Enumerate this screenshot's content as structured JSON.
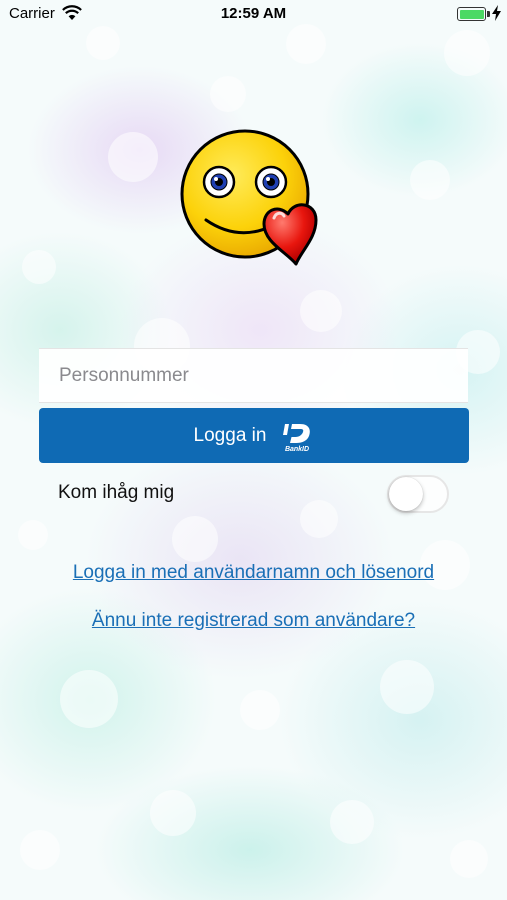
{
  "status_bar": {
    "carrier": "Carrier",
    "time": "12:59 AM",
    "battery_level": 1.0,
    "battery_color": "#4cd964"
  },
  "logo": {
    "icon": "smiley-heart-icon"
  },
  "login": {
    "personnummer_placeholder": "Personnummer",
    "personnummer_value": "",
    "button_label": "Logga in",
    "button_icon": "bankid-icon",
    "button_color": "#0f6ab4"
  },
  "remember_me": {
    "label": "Kom ihåg mig",
    "checked": false
  },
  "links": {
    "password_login": "Logga in med användarnamn och lösenord",
    "register": "Ännu inte registrerad som användare?"
  },
  "link_color": "#1a6fb6"
}
